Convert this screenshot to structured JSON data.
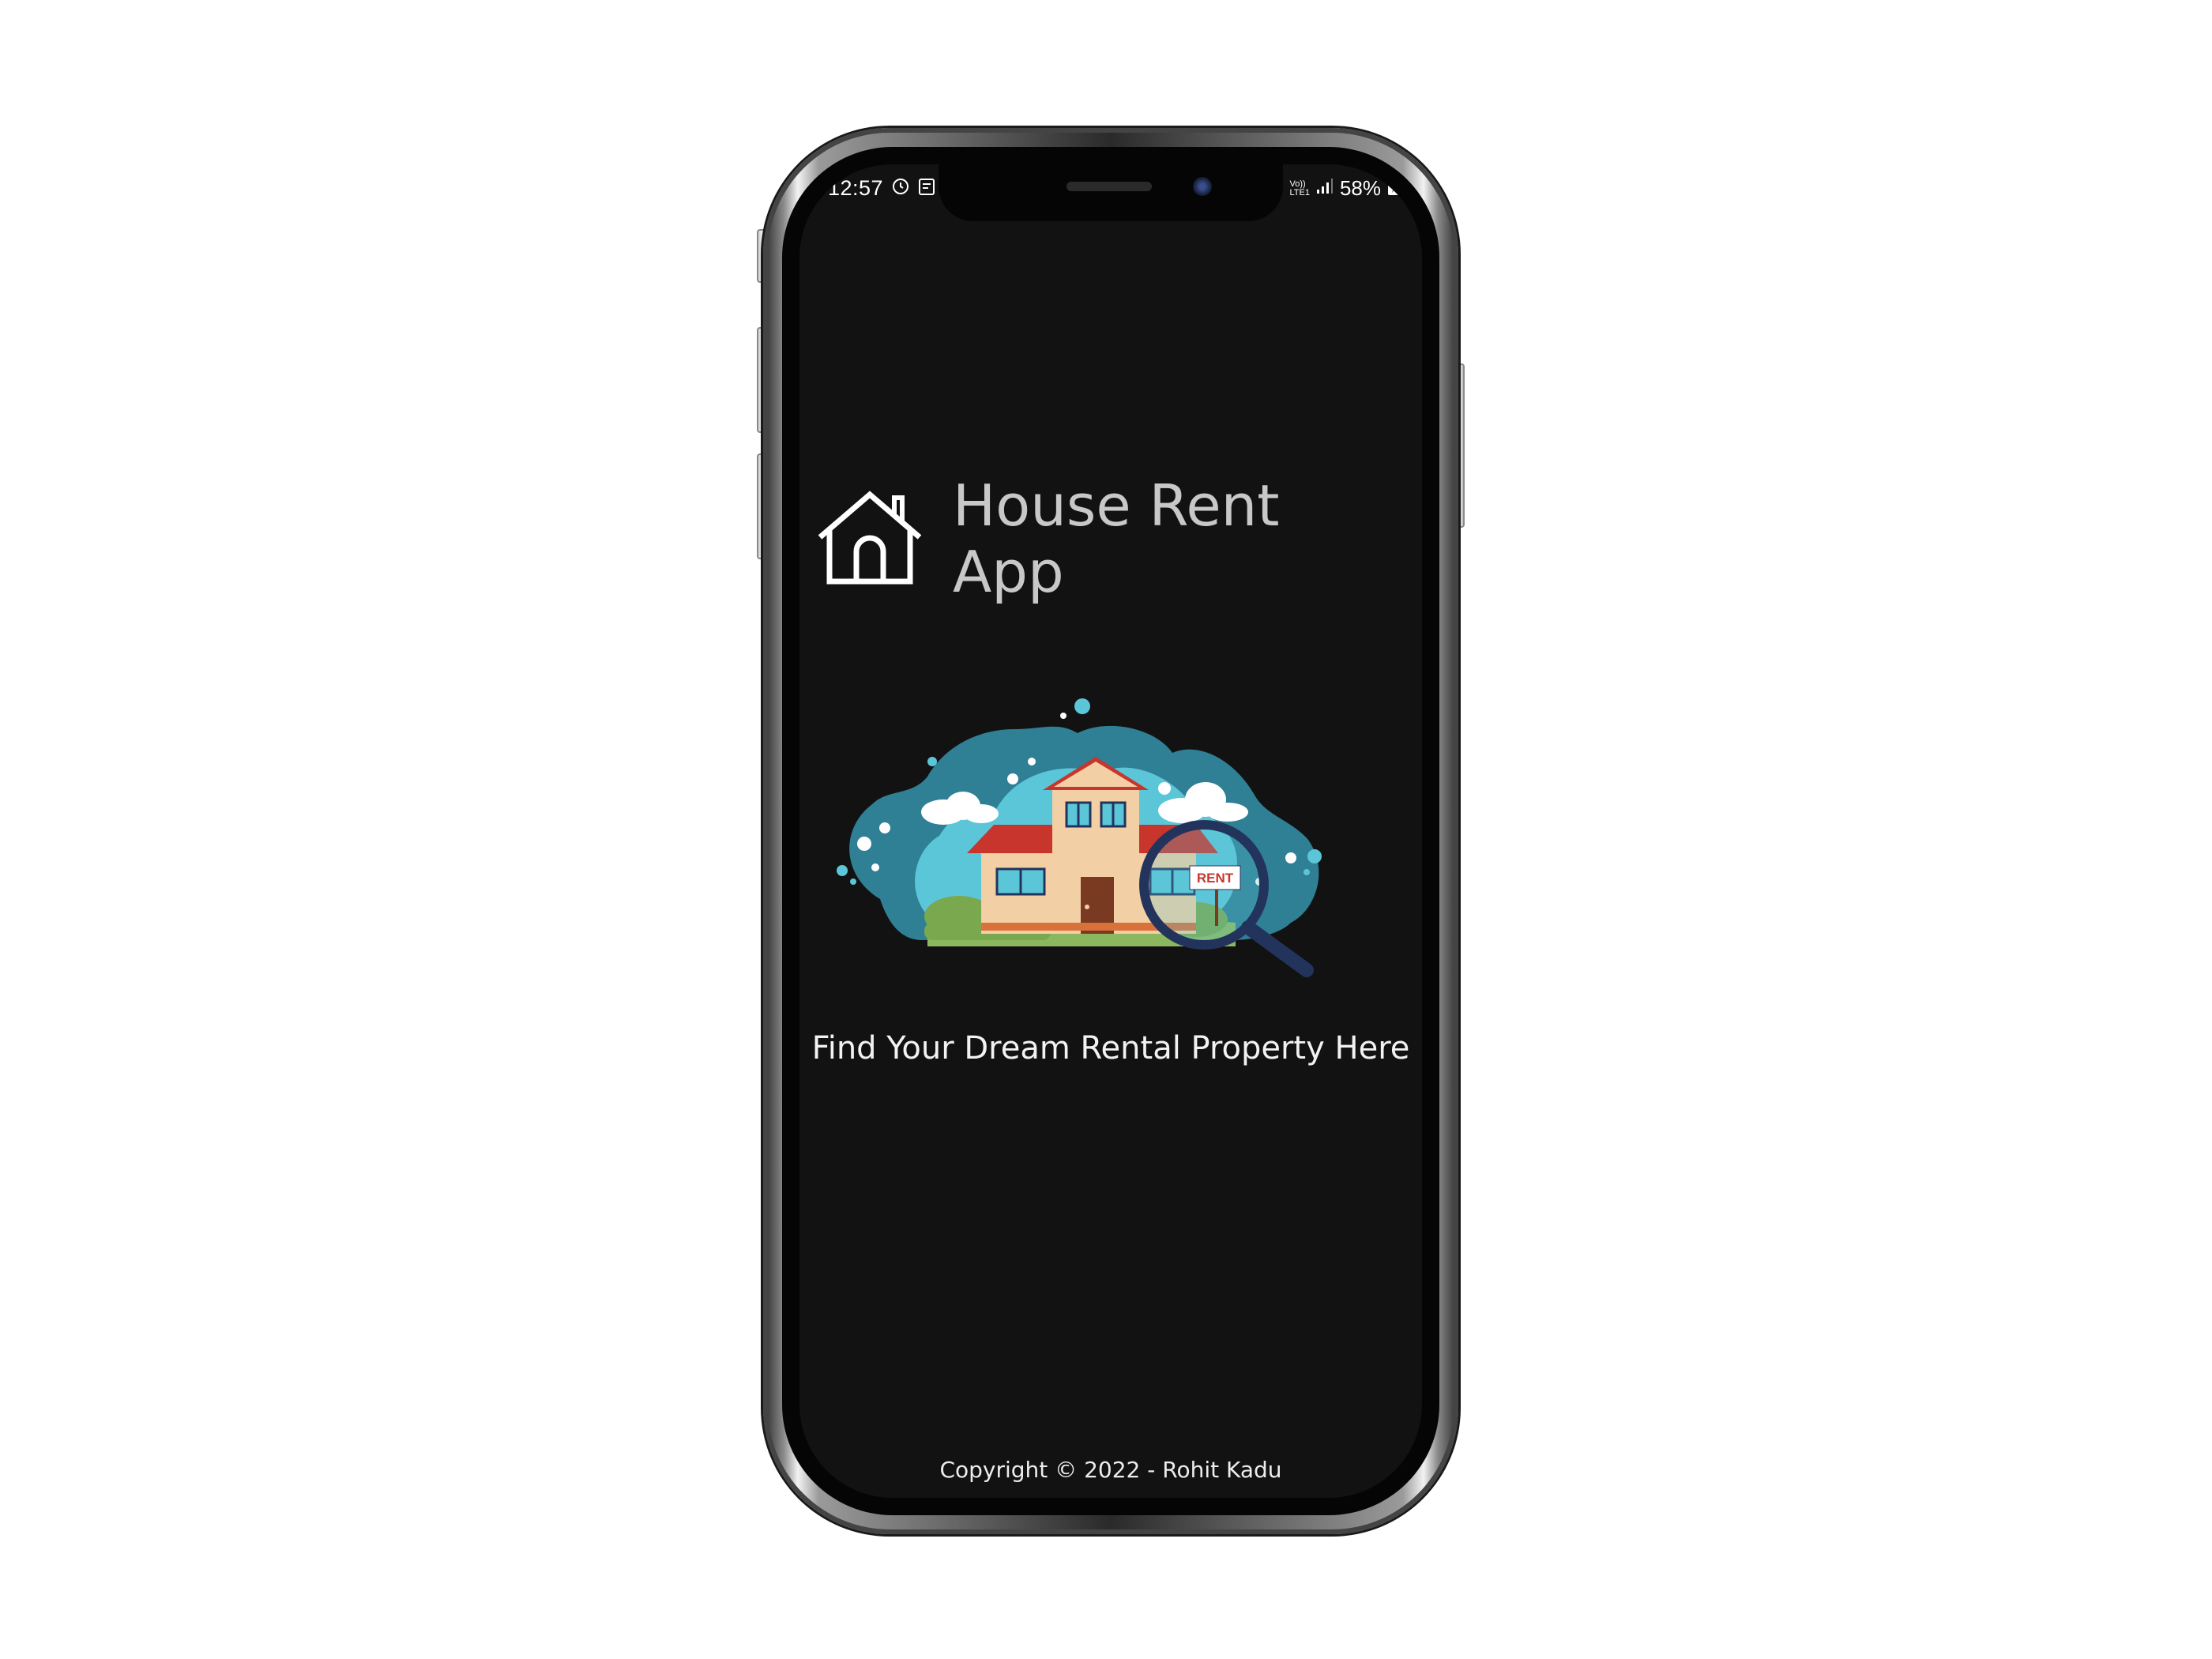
{
  "status_bar": {
    "time": "12:57",
    "network_top": "Vo))",
    "network_bottom": "LTE1",
    "battery": "58%"
  },
  "app": {
    "title": "House Rent App",
    "tagline": "Find Your Dream Rental Property Here",
    "copyright": "Copyright © 2022 - Rohit Kadu",
    "sign_text": "RENT"
  },
  "colors": {
    "screen_bg": "#121212",
    "title": "#c8c8c8",
    "blob_dark": "#2f7f95",
    "blob_light": "#5cc6d9",
    "roof": "#c8352c",
    "wall": "#f2cfa4",
    "magnifier": "#23345c"
  },
  "icons": [
    "home-outline-icon",
    "sync-icon",
    "clipboard-icon",
    "signal-icon",
    "battery-charging-icon"
  ]
}
